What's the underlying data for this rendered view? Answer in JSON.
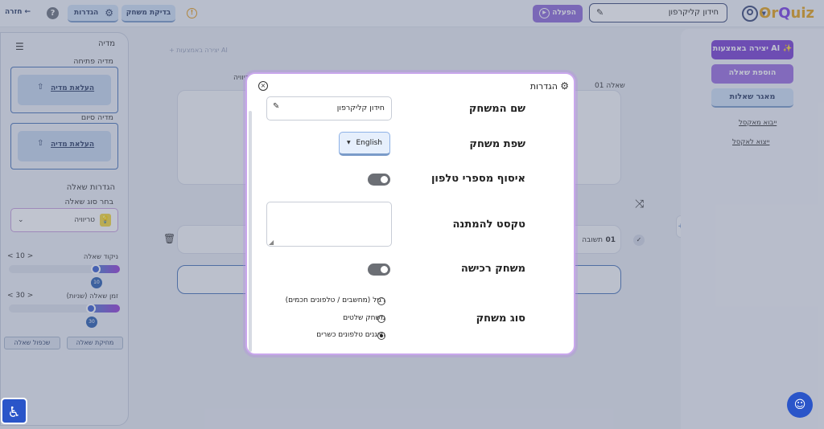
{
  "topbar": {
    "logo_pre": "Or",
    "logo_q": "Q",
    "logo_post": "uiz",
    "game_name": "חידון קליקרפון",
    "activate_label": "הפעלה",
    "check_label": "בדיקת משחק",
    "settings_label": "הגדרות",
    "help_label": "?",
    "back_label": "חזרה ←"
  },
  "left_panel": {
    "media_title": "מדיה",
    "opening_media": "מדיה פתיחה",
    "upload_label_1": "העלאת מדיה",
    "ending_media": "מדיה סיום",
    "upload_label_2": "העלאת מדיה",
    "question_settings_title": "הגדרות שאלה",
    "choose_type_label": "בחר סוג שאלה",
    "question_type": "טריוויה",
    "score_label": "ניקוד שאלה",
    "score_stepper": "< 10 >",
    "score_value": "10",
    "time_label": "זמן שאלה (שניות)",
    "time_stepper": "< 30 >",
    "time_value": "30",
    "delete_question": "מחיקת שאלה",
    "duplicate_question": "שכפול שאלה"
  },
  "main_bg": {
    "faint_hint": "+ יצירה באמצעות AI",
    "question_number": "שאלה 01",
    "question_type": "טריוויה",
    "answer_label": "תשובה",
    "answer_number": "01"
  },
  "right_panel": {
    "ai_create": "יצירה באמצעות AI",
    "add_question": "הוספת שאלה",
    "question_bank": "מאגר שאלות",
    "import_excel": "ייבוא מאקסל",
    "export_excel": "ייצוא לאקסל"
  },
  "modal": {
    "title": "הגדרות",
    "game_name_label": "שם המשחק",
    "game_name_value": "חידון קליקרפון",
    "language_label": "שפת משחק",
    "language_value": "English",
    "phone_collect_label": "איסוף מספרי טלפון",
    "phone_collect_on": true,
    "welcome_text_label": "טקסט להמתנה",
    "welcome_text_value": "",
    "purchase_game_label": "משחק רכישה",
    "purchase_game_on": true,
    "game_type_label": "סוג משחק",
    "game_type_options": [
      "רגיל (מחשבים / טלפונים חכמים)",
      "משחק שלטים",
      "חייגנים טלפונים כשרים"
    ],
    "game_type_selected": 2
  },
  "colors": {
    "accent_purple": "#8f6bd8",
    "brand_blue": "#2a55c9",
    "logo_orange": "#e6a319"
  }
}
